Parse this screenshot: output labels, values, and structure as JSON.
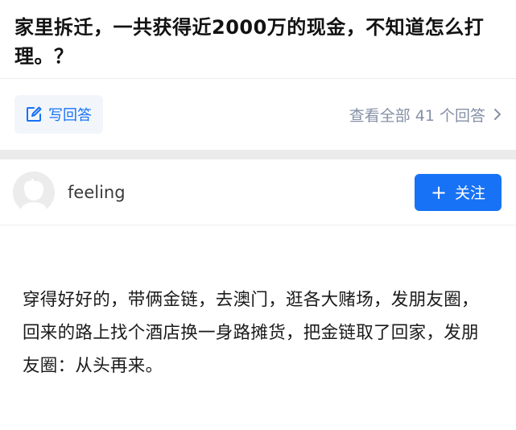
{
  "question": {
    "title": "家里拆迁，一共获得近2000万的现金，不知道怎么打理。？"
  },
  "actions": {
    "write_answer_label": "写回答",
    "view_all_label": "查看全部 41 个回答"
  },
  "answer": {
    "author_name": "feeling",
    "follow_label": "关注",
    "content": "穿得好好的，带俩金链，去澳门，逛各大赌场，发朋友圈，回来的路上找个酒店换一身路摊货，把金链取了回家，发朋友圈：从头再来。"
  },
  "colors": {
    "accent": "#1772f6",
    "muted": "#8590a6",
    "divider": "#ebebeb"
  },
  "icons": {
    "write": "edit-icon",
    "chevron": "chevron-right-icon",
    "plus": "plus-icon",
    "avatar": "avatar-placeholder-icon"
  }
}
